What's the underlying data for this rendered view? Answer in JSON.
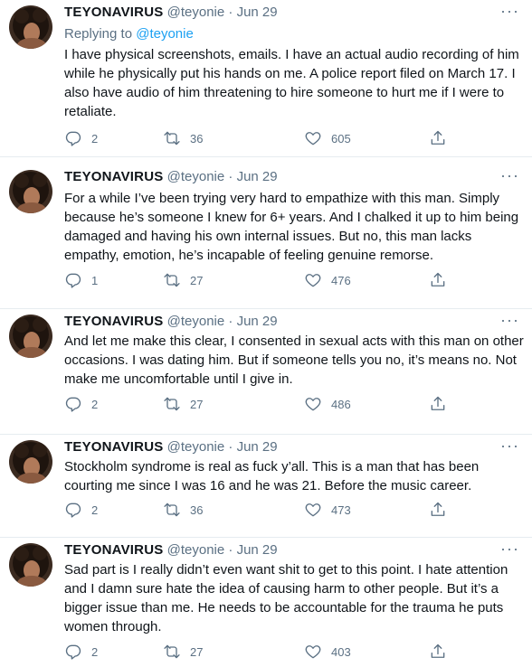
{
  "tweets": [
    {
      "name": "TEYONAVIRUS",
      "handle": "@teyonie",
      "separator": "·",
      "date": "Jun 29",
      "replying_prefix": "Replying to",
      "replying_to": "@teyonie",
      "text": "I have physical screenshots, emails. I have an actual audio recording of him while he physically put his hands on me. A police report filed on March 17. I also have audio of him threatening to hire someone to hurt me if I were to retaliate.",
      "replies": "2",
      "retweets": "36",
      "likes": "605"
    },
    {
      "name": "TEYONAVIRUS",
      "handle": "@teyonie",
      "separator": "·",
      "date": "Jun 29",
      "text": "For a while I’ve been trying very hard to empathize with this man. Simply because he’s someone I knew for 6+ years. And I chalked it up to him being damaged and having his own internal issues. But no, this man lacks empathy, emotion, he’s incapable of feeling genuine remorse.",
      "replies": "1",
      "retweets": "27",
      "likes": "476"
    },
    {
      "name": "TEYONAVIRUS",
      "handle": "@teyonie",
      "separator": "·",
      "date": "Jun 29",
      "text": "And let me make this clear, I consented in sexual acts with this man on other occasions. I was dating him. But if someone tells you no, it’s means no. Not make me uncomfortable until I give in.",
      "replies": "2",
      "retweets": "27",
      "likes": "486"
    },
    {
      "name": "TEYONAVIRUS",
      "handle": "@teyonie",
      "separator": "·",
      "date": "Jun 29",
      "text": "Stockholm syndrome is real as fuck y’all. This is a man that has been courting me since I was 16 and he was 21. Before the music career.",
      "replies": "2",
      "retweets": "36",
      "likes": "473"
    },
    {
      "name": "TEYONAVIRUS",
      "handle": "@teyonie",
      "separator": "·",
      "date": "Jun 29",
      "text": "Sad part is I really didn’t even want shit to get to this point. I hate attention and I damn sure hate the idea of causing harm to other people. But it’s a bigger issue than me. He needs to be accountable for the trauma he puts women through.",
      "replies": "2",
      "retweets": "27",
      "likes": "403"
    }
  ],
  "more_glyph": "···",
  "colors": {
    "text": "#0f1419",
    "secondary": "#5b7083",
    "link": "#1da1f2",
    "divider": "#e6ecf0"
  },
  "icons": [
    "avatar",
    "more-icon",
    "reply-icon",
    "retweet-icon",
    "like-icon",
    "share-icon"
  ]
}
